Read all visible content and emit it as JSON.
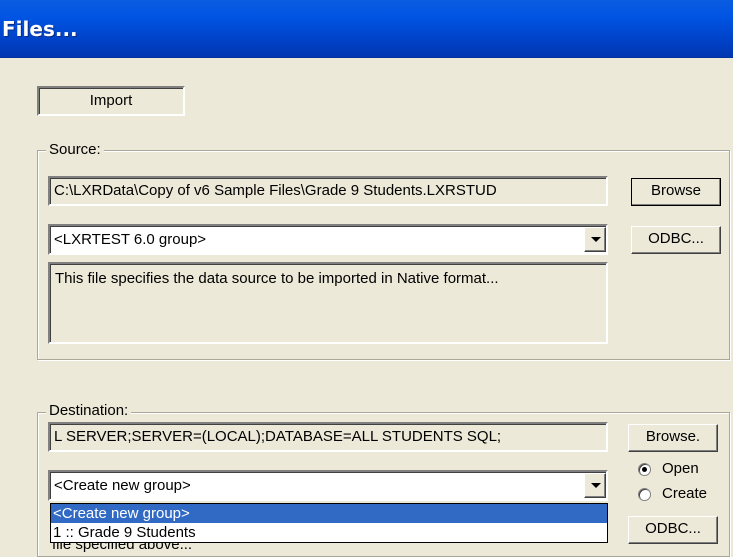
{
  "window": {
    "title": "Files..."
  },
  "import_button": {
    "label": "Import"
  },
  "source": {
    "group_label": "Source:",
    "file_path": "C:\\LXRData\\Copy of v6 Sample Files\\Grade 9 Students.LXRSTUD",
    "browse_label": "Browse",
    "group_select_value": "<LXRTEST 6.0 group>",
    "odbc_label": "ODBC...",
    "description": "This file specifies the data source to be imported in Native format..."
  },
  "destination": {
    "group_label": "Destination:",
    "connection_string": "L SERVER;SERVER=(LOCAL);DATABASE=ALL STUDENTS SQL;",
    "browse_label": "Browse.",
    "group_select_value": "<Create new group>",
    "odbc_label": "ODBC...",
    "radio_open_label": "Open",
    "radio_create_label": "Create",
    "selected_mode": "Open",
    "dropdown_options": [
      "<Create new group>",
      "1 :: Grade 9 Students"
    ],
    "dropdown_selected_index": 0,
    "description_partial": "file specified above..."
  },
  "icons": {
    "combo_arrow": "chevron-down-icon",
    "radio": "radio-icon"
  }
}
